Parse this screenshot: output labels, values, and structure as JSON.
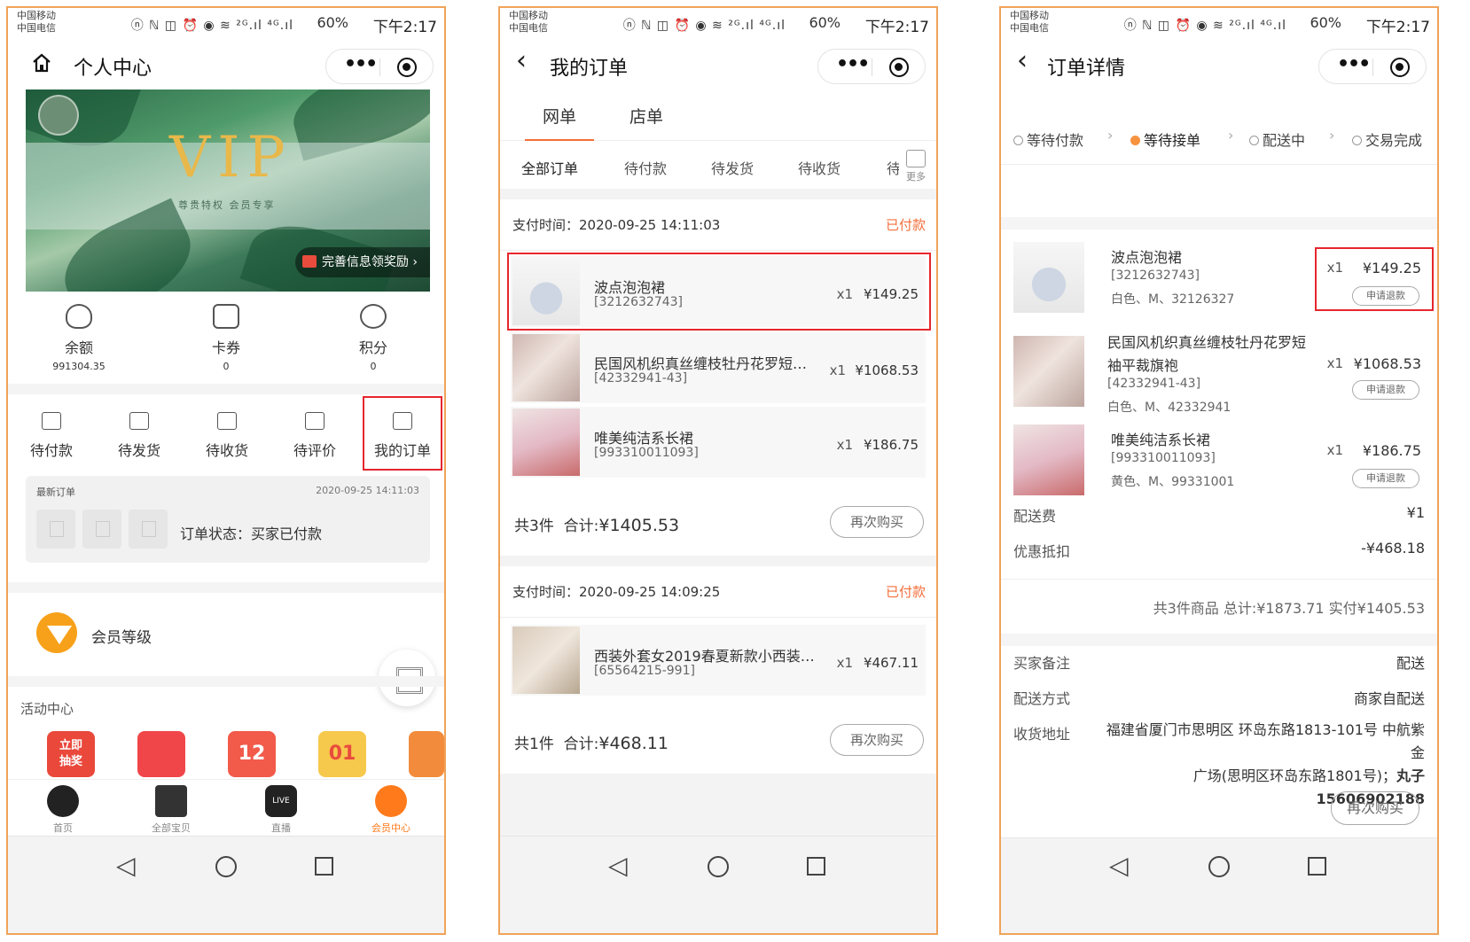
{
  "status": {
    "carrier1": "中国移动",
    "carrier2": "中国电信",
    "icons": "ⓝ ℕ ◫ ⏰ ◉ ≋ ²ᴳ.ıl ⁴ᴳ.ıl",
    "battery_pct": "60%",
    "time": "下午2:17"
  },
  "p1": {
    "title": "个人中心",
    "banner": {
      "vip": "VIP",
      "sub": "尊贵特权 会员专享",
      "reward": "完善信息领奖励 ›"
    },
    "assets": [
      {
        "label": "余额",
        "value": "991304.35"
      },
      {
        "label": "卡券",
        "value": "0"
      },
      {
        "label": "积分",
        "value": "0"
      }
    ],
    "orders": [
      "待付款",
      "待发货",
      "待收货",
      "待评价",
      "我的订单"
    ],
    "latest": {
      "title": "最新订单",
      "time": "2020-09-25 14:11:03",
      "status": "订单状态：买家已付款"
    },
    "level_label": "会员等级",
    "activity_title": "活动中心",
    "activities": [
      "立即\n抽奖",
      "",
      "12",
      "01",
      ""
    ],
    "tabs": [
      "首页",
      "全部宝贝",
      "直播",
      "会员中心"
    ],
    "live_badge": "LIVE"
  },
  "p2": {
    "title": "我的订单",
    "segments": [
      "网单",
      "店单"
    ],
    "filters": [
      "全部订单",
      "待付款",
      "待发货",
      "待收货",
      "待"
    ],
    "more": "更多",
    "orders": [
      {
        "pay_time": "支付时间：2020-09-25 14:11:03",
        "status": "已付款",
        "items": [
          {
            "name": "波点泡泡裙",
            "code": "[3212632743]",
            "qty": "x1",
            "price": "¥149.25"
          },
          {
            "name": "民国风机织真丝缠枝牡丹花罗短…",
            "code": "[42332941-43]",
            "qty": "x1",
            "price": "¥1068.53"
          },
          {
            "name": "唯美纯洁系长裙",
            "code": "[993310011093]",
            "qty": "x1",
            "price": "¥186.75"
          }
        ],
        "count": "共3件",
        "total_label": "合计:",
        "total": "¥1405.53",
        "rebuy": "再次购买"
      },
      {
        "pay_time": "支付时间：2020-09-25 14:09:25",
        "status": "已付款",
        "items": [
          {
            "name": "西装外套女2019春夏新款小西装韩…",
            "code": "[65564215-991]",
            "qty": "x1",
            "price": "¥467.11"
          }
        ],
        "count": "共1件",
        "total_label": "合计:",
        "total": "¥468.11",
        "rebuy": "再次购买"
      }
    ]
  },
  "p3": {
    "title": "订单详情",
    "steps": [
      "等待付款",
      "等待接单",
      "配送中",
      "交易完成"
    ],
    "items": [
      {
        "l1": "波点泡泡裙",
        "l2": "[3212632743]",
        "l3": "白色、M、32126327",
        "qty": "x1",
        "price": "¥149.25",
        "refund": "申请退款"
      },
      {
        "l1": "民国风机织真丝缠枝牡丹花罗短",
        "l1b": "袖平裁旗袍",
        "l2": "[42332941-43]",
        "l3": "白色、M、42332941",
        "qty": "x1",
        "price": "¥1068.53",
        "refund": "申请退款"
      },
      {
        "l1": "唯美纯洁系长裙",
        "l2": "[993310011093]",
        "l3": "黄色、M、99331001",
        "qty": "x1",
        "price": "¥186.75",
        "refund": "申请退款"
      }
    ],
    "shipping_fee_label": "配送费",
    "shipping_fee": "¥1",
    "discount_label": "优惠抵扣",
    "discount": "-¥468.18",
    "summary": "共3件商品  总计:¥1873.71  实付¥1405.53",
    "remark_label": "买家备注",
    "remark": "配送",
    "delivery_label": "配送方式",
    "delivery": "商家自配送",
    "address_label": "收货地址",
    "address_line1": "福建省厦门市思明区 环岛东路1813-101号 中航紫金",
    "address_line2": "广场(思明区环岛东路1801号)；",
    "address_contact": "丸子 15606902188",
    "rebuy": "再次购买"
  },
  "colors": {
    "accent": "#f36f3b",
    "highlight": "#e6262e",
    "frame": "#f0a35a"
  }
}
